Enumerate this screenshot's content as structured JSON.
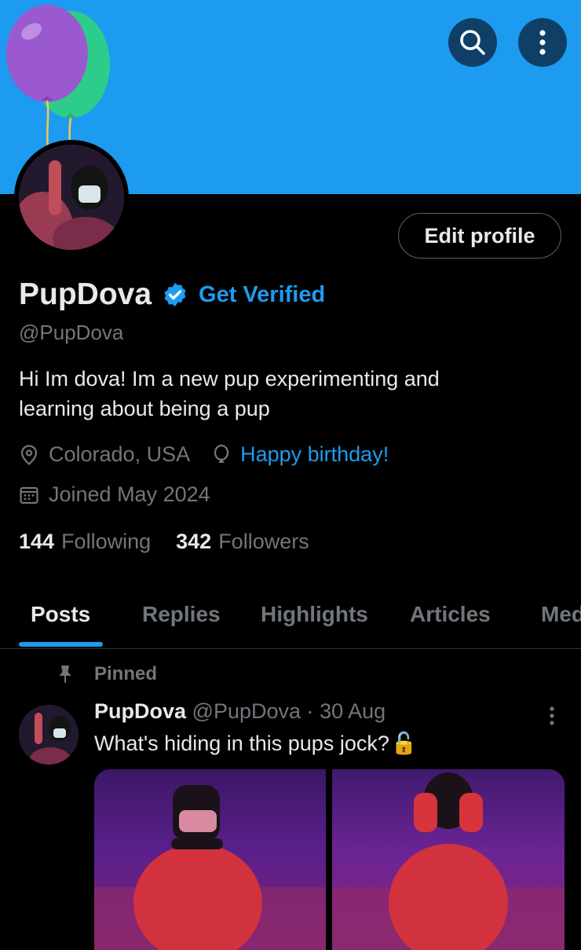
{
  "header": {
    "search_icon": "search-icon",
    "more_icon": "more-vertical-icon",
    "banner_color": "#1d9bf0"
  },
  "profile": {
    "display_name": "PupDova",
    "verified_icon": "verified-badge-icon",
    "get_verified_label": "Get Verified",
    "handle": "@PupDova",
    "edit_profile_label": "Edit profile",
    "bio_line1": "Hi Im dova!  Im a new pup experimenting and",
    "bio_line2": "learning about being a pup",
    "location": "Colorado, USA",
    "birthday_text": "Happy birthday!",
    "joined": "Joined May 2024",
    "following_count": "144",
    "following_label": "Following",
    "followers_count": "342",
    "followers_label": "Followers"
  },
  "tabs": [
    {
      "label": "Posts",
      "active": true
    },
    {
      "label": "Replies",
      "active": false
    },
    {
      "label": "Highlights",
      "active": false
    },
    {
      "label": "Articles",
      "active": false
    },
    {
      "label": "Media",
      "active": false
    }
  ],
  "post": {
    "pinned_label": "Pinned",
    "author_name": "PupDova",
    "author_handle": "@PupDova",
    "separator": "·",
    "date": "30 Aug",
    "text": "What's hiding in this pups jock?",
    "emoji": "🔓"
  },
  "colors": {
    "accent": "#1d9bf0",
    "text_primary": "#e7e9ea",
    "text_secondary": "#71767b",
    "background": "#000000"
  }
}
